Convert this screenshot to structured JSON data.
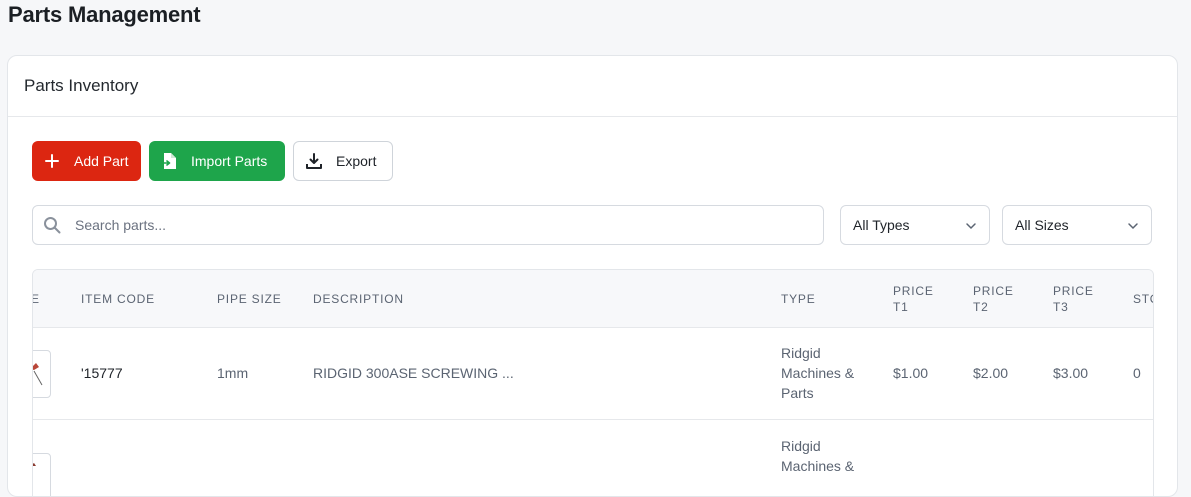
{
  "page": {
    "title": "Parts Management"
  },
  "card": {
    "title": "Parts Inventory"
  },
  "toolbar": {
    "add_label": "Add Part",
    "import_label": "Import Parts",
    "export_label": "Export"
  },
  "search": {
    "placeholder": "Search parts...",
    "value": ""
  },
  "filters": {
    "type_selected": "All Types",
    "size_selected": "All Sizes"
  },
  "table": {
    "headers": {
      "image": "E",
      "item_code": "ITEM CODE",
      "pipe_size": "PIPE SIZE",
      "description": "DESCRIPTION",
      "type": "TYPE",
      "price_t1_a": "PRICE",
      "price_t1_b": "T1",
      "price_t2_a": "PRICE",
      "price_t2_b": "T2",
      "price_t3_a": "PRICE",
      "price_t3_b": "T3",
      "stock": "STO"
    },
    "rows": [
      {
        "item_code": "'15777",
        "pipe_size": "1mm",
        "description": "RIDGID 300ASE SCREWING ...",
        "type_l1": "Ridgid",
        "type_l2": "Machines &",
        "type_l3": "Parts",
        "price_t1": "$1.00",
        "price_t2": "$2.00",
        "price_t3": "$3.00",
        "stock": "0"
      },
      {
        "type_l1": "Ridgid",
        "type_l2": "Machines &"
      }
    ]
  },
  "colors": {
    "primary_red": "#dc2611",
    "import_green": "#1ea54b"
  }
}
